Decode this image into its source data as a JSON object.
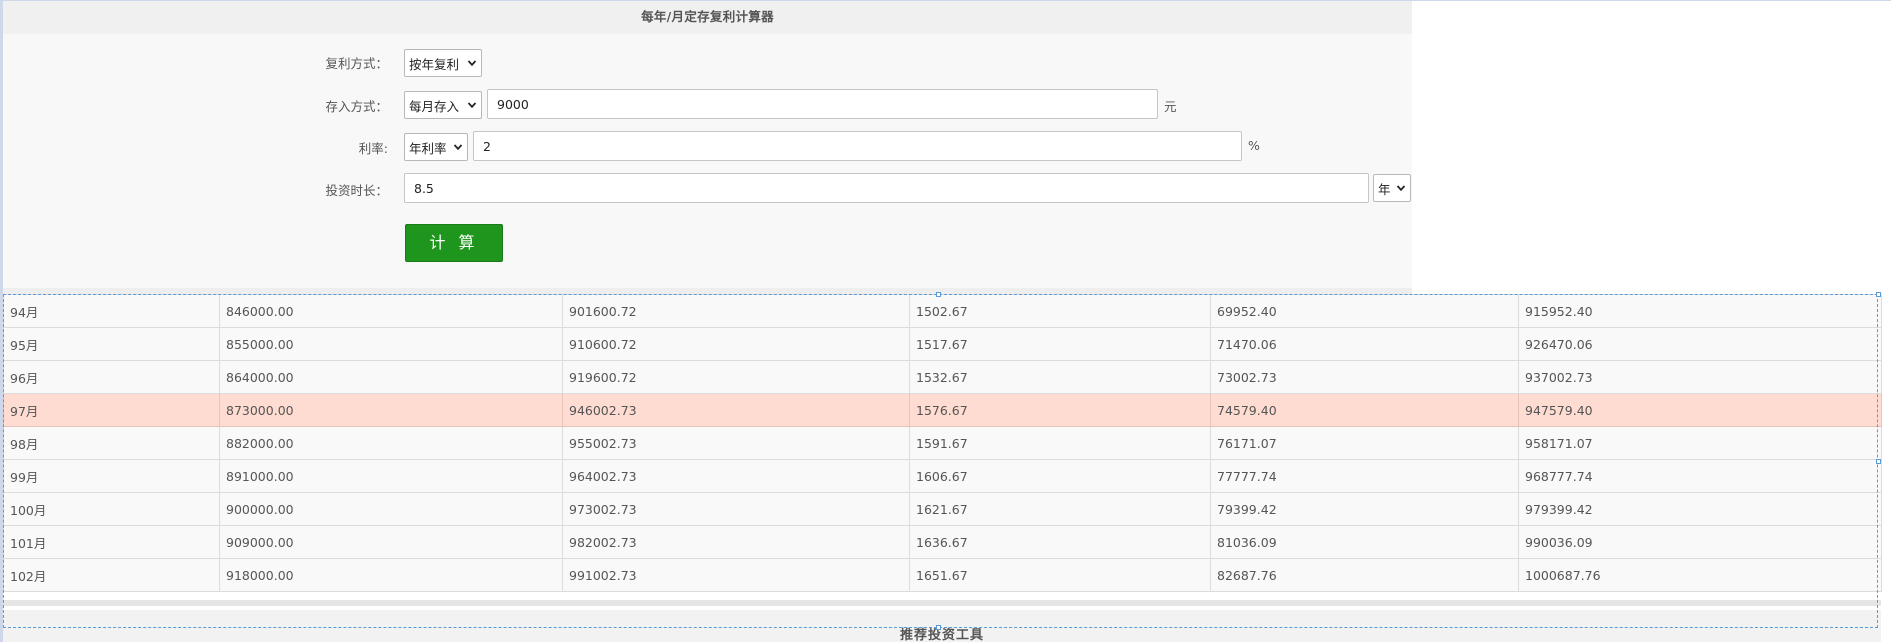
{
  "calculator": {
    "title": "每年/月定存复利计算器",
    "compound_label": "复利方式：",
    "compound_value": "按年复利",
    "deposit_label": "存入方式：",
    "deposit_mode_value": "每月存入",
    "deposit_amount": "9000",
    "deposit_unit": "元",
    "rate_label": "利率:",
    "rate_type_value": "年利率",
    "rate_value": "2",
    "rate_unit": "%",
    "duration_label": "投资时长：",
    "duration_value": "8.5",
    "duration_unit_value": "年",
    "calc_button": "计 算"
  },
  "table": {
    "rows": [
      [
        "94月",
        "846000.00",
        "901600.72",
        "1502.67",
        "69952.40",
        "915952.40"
      ],
      [
        "95月",
        "855000.00",
        "910600.72",
        "1517.67",
        "71470.06",
        "926470.06"
      ],
      [
        "96月",
        "864000.00",
        "919600.72",
        "1532.67",
        "73002.73",
        "937002.73"
      ],
      [
        "97月",
        "873000.00",
        "946002.73",
        "1576.67",
        "74579.40",
        "947579.40"
      ],
      [
        "98月",
        "882000.00",
        "955002.73",
        "1591.67",
        "76171.07",
        "958171.07"
      ],
      [
        "99月",
        "891000.00",
        "964002.73",
        "1606.67",
        "77777.74",
        "968777.74"
      ],
      [
        "100月",
        "900000.00",
        "973002.73",
        "1621.67",
        "79399.42",
        "979399.42"
      ],
      [
        "101月",
        "909000.00",
        "982002.73",
        "1636.67",
        "81036.09",
        "990036.09"
      ],
      [
        "102月",
        "918000.00",
        "991002.73",
        "1651.67",
        "82687.76",
        "1000687.76"
      ]
    ],
    "highlighted_row": 3
  },
  "footer": {
    "partial_text": "推荐投资工具"
  },
  "colors": {
    "button_green": "#1e961e",
    "highlight_row": "#ffdcd2",
    "selection_blue": "#5b9bd5"
  }
}
